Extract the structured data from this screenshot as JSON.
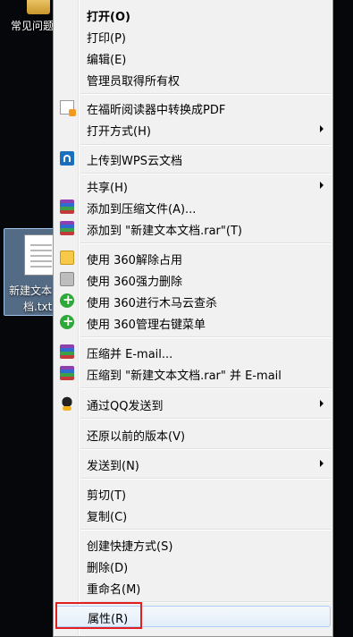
{
  "desktop": {
    "top_icon_label": "常见问题",
    "file_label_line1": "新建文本",
    "file_label_line2": "档.txt"
  },
  "menu": {
    "items": [
      {
        "label": "打开(O)",
        "bold": true
      },
      {
        "label": "打印(P)"
      },
      {
        "label": "编辑(E)"
      },
      {
        "label": "管理员取得所有权"
      },
      {
        "label": "在福昕阅读器中转换成PDF",
        "icon": "pdf-convert-icon"
      },
      {
        "label": "打开方式(H)",
        "submenu": true
      },
      {
        "label": "上传到WPS云文档",
        "icon": "wps-cloud-icon"
      },
      {
        "label": "共享(H)",
        "submenu": true
      },
      {
        "label": "添加到压缩文件(A)...",
        "icon": "winrar-icon"
      },
      {
        "label": "添加到 \"新建文本文档.rar\"(T)",
        "icon": "winrar-icon"
      },
      {
        "label": "使用 360解除占用",
        "icon": "360-unlock-icon"
      },
      {
        "label": "使用 360强力删除",
        "icon": "360-shred-icon"
      },
      {
        "label": "使用 360进行木马云查杀",
        "icon": "360-scan-icon"
      },
      {
        "label": "使用 360管理右键菜单",
        "icon": "360-menu-icon"
      },
      {
        "label": "压缩并 E-mail...",
        "icon": "winrar-icon"
      },
      {
        "label": "压缩到 \"新建文本文档.rar\" 并 E-mail",
        "icon": "winrar-icon"
      },
      {
        "label": "通过QQ发送到",
        "icon": "qq-icon",
        "submenu": true
      },
      {
        "label": "还原以前的版本(V)"
      },
      {
        "label": "发送到(N)",
        "submenu": true
      },
      {
        "label": "剪切(T)"
      },
      {
        "label": "复制(C)"
      },
      {
        "label": "创建快捷方式(S)"
      },
      {
        "label": "删除(D)"
      },
      {
        "label": "重命名(M)"
      },
      {
        "label": "属性(R)",
        "highlighted": true
      }
    ]
  },
  "colors": {
    "menu_bg": "#f1f1f1",
    "highlight_border": "#e02020"
  }
}
